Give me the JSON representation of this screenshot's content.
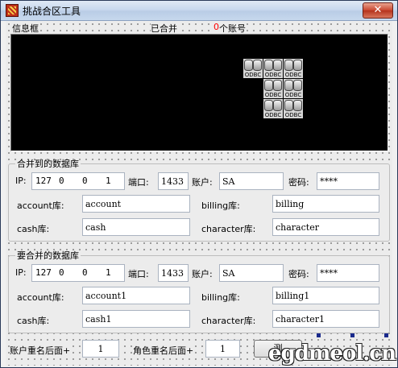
{
  "window": {
    "title": "挑战合区工具",
    "close_glyph": "✕"
  },
  "info": {
    "frame_label": "信息框",
    "merged_label": "已合并",
    "merged_count": "0",
    "count_unit": "个账号"
  },
  "target_db": {
    "legend": "合并到的数据库",
    "ip_label": "IP:",
    "ip_octets": [
      "127",
      "0",
      "0",
      "1"
    ],
    "port_label": "端口:",
    "port_value": "1433",
    "user_label": "账户:",
    "user_value": "SA",
    "password_label": "密码:",
    "password_value": "****",
    "account_label": "account库:",
    "account_value": "account",
    "billing_label": "billing库:",
    "billing_value": "billing",
    "cash_label": "cash库:",
    "cash_value": "cash",
    "character_label": "character库:",
    "character_value": "character"
  },
  "source_db": {
    "legend": "要合并的数据库",
    "ip_label": "IP:",
    "ip_octets": [
      "127",
      "0",
      "0",
      "1"
    ],
    "port_label": "端口:",
    "port_value": "1433",
    "user_label": "账户:",
    "user_value": "SA",
    "password_label": "密码:",
    "password_value": "****",
    "account_label": "account库:",
    "account_value": "account1",
    "billing_label": "billing库:",
    "billing_value": "billing1",
    "cash_label": "cash库:",
    "cash_value": "cash1",
    "character_label": "character库:",
    "character_value": "character1"
  },
  "footer": {
    "account_suffix_label": "账户重名后面+",
    "account_suffix_value": "1",
    "role_suffix_label": "角色重名后面+",
    "role_suffix_value": "1",
    "test_button_label": "测"
  },
  "odbc_caption": "ODBC",
  "watermark": "egdmeol.cn",
  "colors": {
    "count_red": "#ff0000",
    "info_bg": "#000000",
    "title_bar": "#c8d9ee",
    "close_red": "#c8452e",
    "handle_blue": "#1a2a8c"
  },
  "icons": {
    "app": "fire-logo-icon",
    "odbc": "odbc-database-icon"
  }
}
